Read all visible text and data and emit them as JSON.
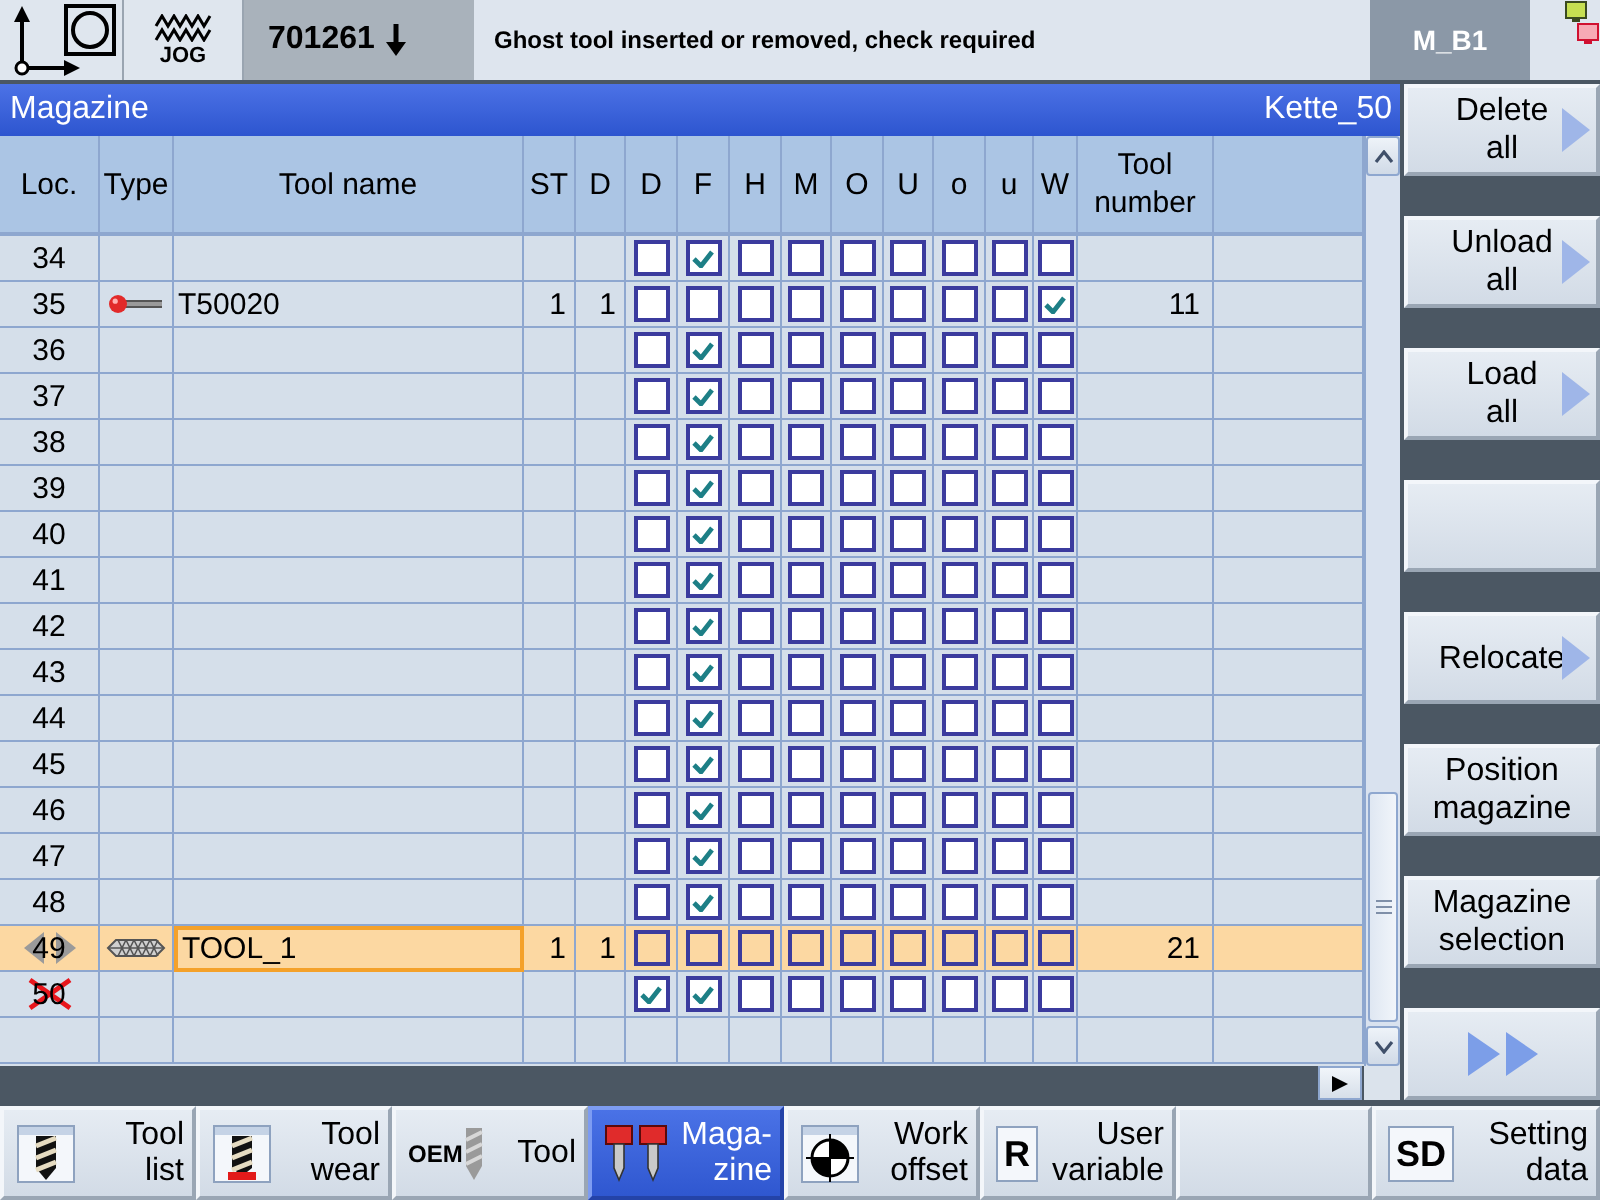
{
  "header": {
    "mode": "JOG",
    "program": "701261",
    "message": "Ghost tool inserted or removed, check required",
    "channel": "M_B1"
  },
  "title_bar": {
    "title": "Magazine",
    "magazine": "Kette_50"
  },
  "table": {
    "columns": [
      "Loc.",
      "Type",
      "Tool name",
      "ST",
      "D",
      "D",
      "F",
      "H",
      "M",
      "O",
      "U",
      "o",
      "u",
      "W",
      "Tool\nnumber"
    ],
    "rows": [
      {
        "loc": "34",
        "kind": "empty",
        "flags": [
          false,
          true,
          false,
          false,
          false,
          false,
          false,
          false,
          false
        ],
        "selected": false,
        "disabled": false,
        "load_point": false
      },
      {
        "loc": "35",
        "kind": "probe",
        "tool_name": "T50020",
        "st": "1",
        "d": "1",
        "flags": [
          false,
          false,
          false,
          false,
          false,
          false,
          false,
          false,
          true
        ],
        "tool_number": "11",
        "selected": false,
        "disabled": false,
        "load_point": false
      },
      {
        "loc": "36",
        "kind": "empty",
        "flags": [
          false,
          true,
          false,
          false,
          false,
          false,
          false,
          false,
          false
        ],
        "selected": false,
        "disabled": false,
        "load_point": false
      },
      {
        "loc": "37",
        "kind": "empty",
        "flags": [
          false,
          true,
          false,
          false,
          false,
          false,
          false,
          false,
          false
        ],
        "selected": false,
        "disabled": false,
        "load_point": false
      },
      {
        "loc": "38",
        "kind": "empty",
        "flags": [
          false,
          true,
          false,
          false,
          false,
          false,
          false,
          false,
          false
        ],
        "selected": false,
        "disabled": false,
        "load_point": false
      },
      {
        "loc": "39",
        "kind": "empty",
        "flags": [
          false,
          true,
          false,
          false,
          false,
          false,
          false,
          false,
          false
        ],
        "selected": false,
        "disabled": false,
        "load_point": false
      },
      {
        "loc": "40",
        "kind": "empty",
        "flags": [
          false,
          true,
          false,
          false,
          false,
          false,
          false,
          false,
          false
        ],
        "selected": false,
        "disabled": false,
        "load_point": false
      },
      {
        "loc": "41",
        "kind": "empty",
        "flags": [
          false,
          true,
          false,
          false,
          false,
          false,
          false,
          false,
          false
        ],
        "selected": false,
        "disabled": false,
        "load_point": false
      },
      {
        "loc": "42",
        "kind": "empty",
        "flags": [
          false,
          true,
          false,
          false,
          false,
          false,
          false,
          false,
          false
        ],
        "selected": false,
        "disabled": false,
        "load_point": false
      },
      {
        "loc": "43",
        "kind": "empty",
        "flags": [
          false,
          true,
          false,
          false,
          false,
          false,
          false,
          false,
          false
        ],
        "selected": false,
        "disabled": false,
        "load_point": false
      },
      {
        "loc": "44",
        "kind": "empty",
        "flags": [
          false,
          true,
          false,
          false,
          false,
          false,
          false,
          false,
          false
        ],
        "selected": false,
        "disabled": false,
        "load_point": false
      },
      {
        "loc": "45",
        "kind": "empty",
        "flags": [
          false,
          true,
          false,
          false,
          false,
          false,
          false,
          false,
          false
        ],
        "selected": false,
        "disabled": false,
        "load_point": false
      },
      {
        "loc": "46",
        "kind": "empty",
        "flags": [
          false,
          true,
          false,
          false,
          false,
          false,
          false,
          false,
          false
        ],
        "selected": false,
        "disabled": false,
        "load_point": false
      },
      {
        "loc": "47",
        "kind": "empty",
        "flags": [
          false,
          true,
          false,
          false,
          false,
          false,
          false,
          false,
          false
        ],
        "selected": false,
        "disabled": false,
        "load_point": false
      },
      {
        "loc": "48",
        "kind": "empty",
        "flags": [
          false,
          true,
          false,
          false,
          false,
          false,
          false,
          false,
          false
        ],
        "selected": false,
        "disabled": false,
        "load_point": false
      },
      {
        "loc": "49",
        "kind": "cutter",
        "tool_name": "TOOL_1",
        "st": "1",
        "d": "1",
        "flags": [
          false,
          false,
          false,
          false,
          false,
          false,
          false,
          false,
          false
        ],
        "tool_number": "21",
        "selected": true,
        "disabled": false,
        "load_point": true
      },
      {
        "loc": "50",
        "kind": "empty",
        "flags": [
          true,
          true,
          false,
          false,
          false,
          false,
          false,
          false,
          false
        ],
        "selected": false,
        "disabled": true,
        "load_point": false
      }
    ]
  },
  "side_softkeys": [
    {
      "kind": "label",
      "label": "Delete\nall",
      "submenu": true
    },
    {
      "kind": "label",
      "label": "Unload\nall",
      "submenu": true
    },
    {
      "kind": "label",
      "label": "Load\nall",
      "submenu": true
    },
    {
      "kind": "blank"
    },
    {
      "kind": "label",
      "label": "Relocate",
      "submenu": true
    },
    {
      "kind": "label",
      "label": "Position\nmagazine",
      "submenu": false
    },
    {
      "kind": "label",
      "label": "Magazine\nselection",
      "submenu": false
    },
    {
      "kind": "more"
    }
  ],
  "softkeys": [
    {
      "kind": "list",
      "label": "Tool\nlist",
      "selected": false
    },
    {
      "kind": "wear",
      "label": "Tool\nwear",
      "selected": false
    },
    {
      "kind": "oem",
      "badge": "OEM",
      "label": "Tool",
      "selected": false
    },
    {
      "kind": "magazine",
      "label": "Maga-\nzine",
      "selected": true
    },
    {
      "kind": "offset",
      "label": "Work\noffset",
      "selected": false
    },
    {
      "kind": "variable",
      "badge": "R",
      "label": "User\nvariable",
      "selected": false
    },
    {
      "kind": "blank",
      "selected": false
    },
    {
      "kind": "setting",
      "badge": "SD",
      "label": "Setting\ndata",
      "selected": false
    }
  ]
}
